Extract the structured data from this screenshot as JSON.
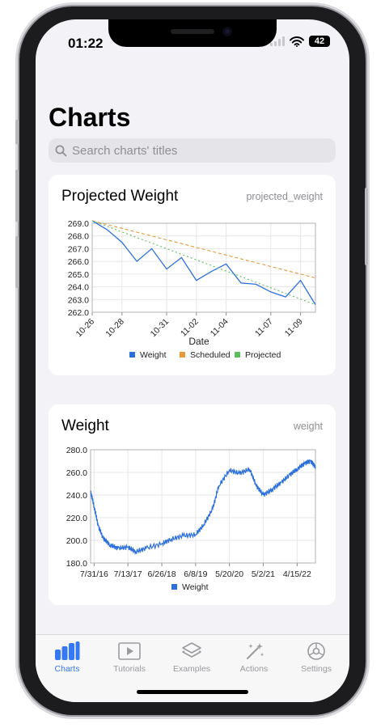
{
  "status_bar": {
    "time": "01:22",
    "battery": "42"
  },
  "page": {
    "title": "Charts",
    "search": {
      "placeholder": "Search charts' titles",
      "icon": "search-icon"
    }
  },
  "colors": {
    "accent": "#3478f6",
    "weight": "#2a6fdb",
    "scheduled": "#e8993a",
    "projected": "#5cbf5c"
  },
  "cards": [
    {
      "title": "Projected Weight",
      "key": "projected_weight"
    },
    {
      "title": "Weight",
      "key": "weight"
    }
  ],
  "chart_data": [
    {
      "type": "line",
      "xlabel": "Date",
      "ylabel": "",
      "ylim": [
        262.0,
        269.0
      ],
      "y_ticks": [
        "269.0",
        "268.0",
        "267.0",
        "266.0",
        "265.0",
        "264.0",
        "263.0",
        "262.0"
      ],
      "x_ticks": [
        "10-26",
        "10-28",
        "10-31",
        "11-02",
        "11-04",
        "11-07",
        "11-09"
      ],
      "x_range_days": [
        0,
        15
      ],
      "x_tick_positions_days": [
        0,
        2,
        5,
        7,
        9,
        12,
        14
      ],
      "legend_position": "bottom",
      "grid": true,
      "series": [
        {
          "name": "Weight",
          "style": "solid",
          "x_days": [
            0,
            1,
            2,
            3,
            4,
            5,
            6,
            7,
            8,
            9,
            10,
            11,
            12,
            13,
            14,
            15
          ],
          "values": [
            269.2,
            268.5,
            267.5,
            266.0,
            267.0,
            265.4,
            266.3,
            264.5,
            265.2,
            265.8,
            264.3,
            264.2,
            263.6,
            263.2,
            264.5,
            262.6
          ]
        },
        {
          "name": "Scheduled",
          "style": "dashed",
          "x_days": [
            0,
            15
          ],
          "values": [
            269.2,
            264.7
          ]
        },
        {
          "name": "Projected",
          "style": "dotted",
          "x_days": [
            0,
            15
          ],
          "values": [
            269.2,
            262.6
          ]
        }
      ]
    },
    {
      "type": "line",
      "ylim": [
        180.0,
        280.0
      ],
      "y_ticks": [
        "280.0",
        "260.0",
        "240.0",
        "220.0",
        "200.0",
        "180.0"
      ],
      "x_ticks": [
        "7/31/16",
        "7/13/17",
        "6/26/18",
        "6/8/19",
        "5/20/20",
        "5/2/21",
        "4/15/22"
      ],
      "legend_position": "bottom",
      "grid": true,
      "series": [
        {
          "name": "Weight",
          "style": "solid",
          "x_dates": [
            "2016-06-25",
            "2016-07-31",
            "2016-09-10",
            "2016-11-01",
            "2017-01-10",
            "2017-04-01",
            "2017-07-13",
            "2017-10-01",
            "2018-01-15",
            "2018-06-26",
            "2018-10-01",
            "2019-02-01",
            "2019-06-08",
            "2019-09-01",
            "2019-12-01",
            "2020-02-01",
            "2020-05-20",
            "2020-09-01",
            "2020-12-15",
            "2021-02-15",
            "2021-05-02",
            "2021-08-01",
            "2021-11-01",
            "2022-02-01",
            "2022-04-15",
            "2022-07-01",
            "2022-09-01",
            "2022-10-20"
          ],
          "values": [
            243,
            230,
            213,
            202,
            196,
            193,
            194,
            190,
            193,
            197,
            201,
            204,
            205,
            214,
            228,
            248,
            262,
            259,
            263,
            249,
            240,
            245,
            251,
            258,
            263,
            268,
            270,
            265
          ]
        }
      ]
    }
  ],
  "tabbar": [
    {
      "label": "Charts",
      "icon": "chart-bars-icon",
      "active": true
    },
    {
      "label": "Tutorials",
      "icon": "play-rectangle-icon",
      "active": false
    },
    {
      "label": "Examples",
      "icon": "stack-icon",
      "active": false
    },
    {
      "label": "Actions",
      "icon": "magic-wand-icon",
      "active": false
    },
    {
      "label": "Settings",
      "icon": "gear-icon",
      "active": false
    }
  ]
}
